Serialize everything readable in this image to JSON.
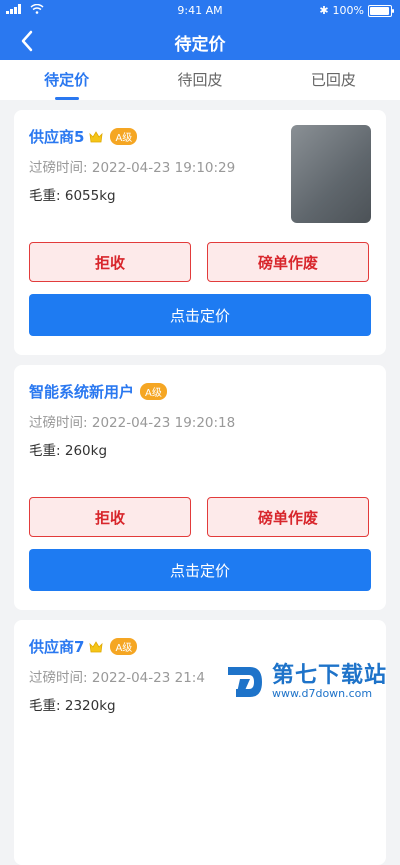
{
  "status_bar": {
    "time": "9:41 AM",
    "battery": "100%"
  },
  "nav": {
    "title": "待定价"
  },
  "tabs": [
    {
      "label": "待定价",
      "active": true
    },
    {
      "label": "待回皮",
      "active": false
    },
    {
      "label": "已回皮",
      "active": false
    }
  ],
  "cards": [
    {
      "name": "供应商5",
      "has_crown": true,
      "level": "A级",
      "time_label": "过磅时间:",
      "time": "2022-04-23 19:10:29",
      "weight_label": "毛重:",
      "weight": "6055kg",
      "has_photo": true,
      "reject_label": "拒收",
      "void_label": "磅单作废",
      "price_label": "点击定价"
    },
    {
      "name": "智能系统新用户",
      "has_crown": false,
      "level": "A级",
      "time_label": "过磅时间:",
      "time": "2022-04-23 19:20:18",
      "weight_label": "毛重:",
      "weight": "260kg",
      "has_photo": false,
      "reject_label": "拒收",
      "void_label": "磅单作废",
      "price_label": "点击定价"
    },
    {
      "name": "供应商7",
      "has_crown": true,
      "level": "A级",
      "time_label": "过磅时间:",
      "time": "2022-04-23 21:4",
      "weight_label": "毛重:",
      "weight": "2320kg",
      "has_photo": false
    }
  ],
  "watermark": {
    "main": "第七下载站",
    "sub": "www.d7down.com"
  },
  "colors": {
    "primary": "#2a78f0",
    "danger": "#d8262c",
    "badge": "#f5a623"
  }
}
